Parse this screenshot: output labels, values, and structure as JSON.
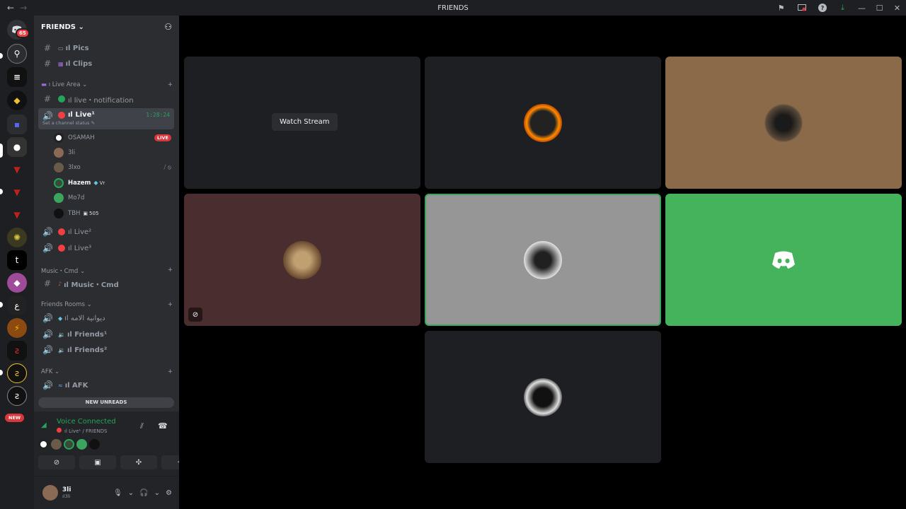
{
  "titlebar": {
    "title": "FRIENDS",
    "back": "←",
    "forward": "→",
    "min": "—",
    "max": "☐",
    "close": "✕",
    "icons": [
      "inbox-flag-icon",
      "screen-share-icon",
      "help-icon",
      "download-icon"
    ]
  },
  "guilds": {
    "home_badge": "65",
    "new_pill": "NEW"
  },
  "sidebar": {
    "server_name": "FRIENDS",
    "channels": {
      "pics": "ıl Pics",
      "clips": "ıl Clips",
      "live_area": "ı Live Area",
      "live_notification": "ıl live・notification",
      "live1": "ıl Live¹",
      "live1_timer": "1:28:24",
      "live1_status": "Set a channel status",
      "live2": "ıl Live²",
      "live3": "ıl Live³",
      "music_cat": "Music・Cmd",
      "music": "ıl Music・Cmd",
      "friends_rooms": "Friends Rooms",
      "arabic": "ıl دیوانیة الامه",
      "friends1": "ıl Friends¹",
      "friends2": "ıl Friends²",
      "afk_cat": "AFK",
      "afk": "ıl AFK"
    },
    "members": [
      {
        "name": "OSAMAH",
        "badge": "LIVE"
      },
      {
        "name": "3li"
      },
      {
        "name": "3lxo"
      },
      {
        "name": "Hazem",
        "tag": "Vr"
      },
      {
        "name": "Mo7d"
      },
      {
        "name": "TBH",
        "tag": "505"
      }
    ],
    "new_unreads": "NEW UNREADS"
  },
  "voice": {
    "status": "Voice Connected",
    "channel": "ıl Live¹ / FRIENDS"
  },
  "user": {
    "name": "3li",
    "sub": "ıl3li"
  },
  "stage": {
    "watch_stream": "Watch Stream"
  },
  "colors": {
    "accent_green": "#23a55a",
    "live_red": "#da373c",
    "discord_green_tile": "#45b35b",
    "tan_tile": "#8b6a4a",
    "maroon_tile": "#4a2d2e",
    "gray_tile": "#969696"
  }
}
